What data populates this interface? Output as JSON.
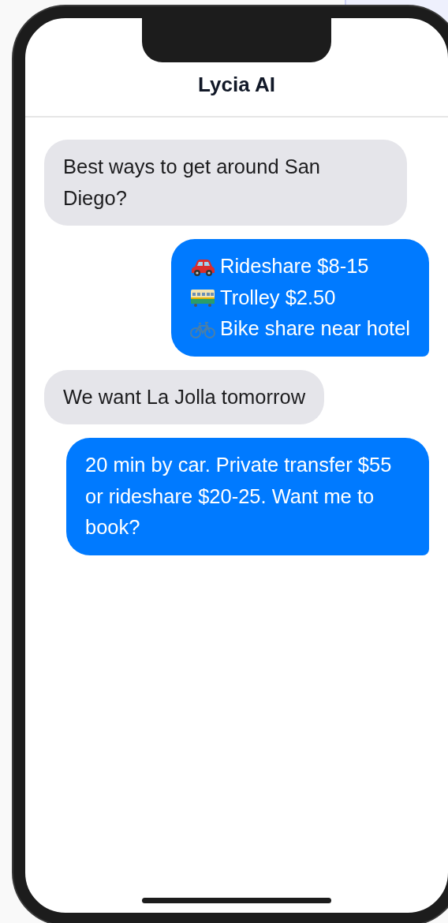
{
  "header": {
    "title": "Lycia AI"
  },
  "messages": [
    {
      "kind": "sent",
      "text": "Best ways to get around San Diego?"
    },
    {
      "kind": "received",
      "lines": [
        {
          "kind": "car",
          "text": "Rideshare $8-15"
        },
        {
          "kind": "tram",
          "text": "Trolley $2.50"
        },
        {
          "kind": "bike",
          "text": "Bike share near hotel"
        }
      ]
    },
    {
      "kind": "sent",
      "text": "We want La Jolla tomorrow"
    },
    {
      "kind": "received",
      "text": "20 min by car. Private transfer $55 or rideshare $20-25. Want me to book?"
    }
  ]
}
